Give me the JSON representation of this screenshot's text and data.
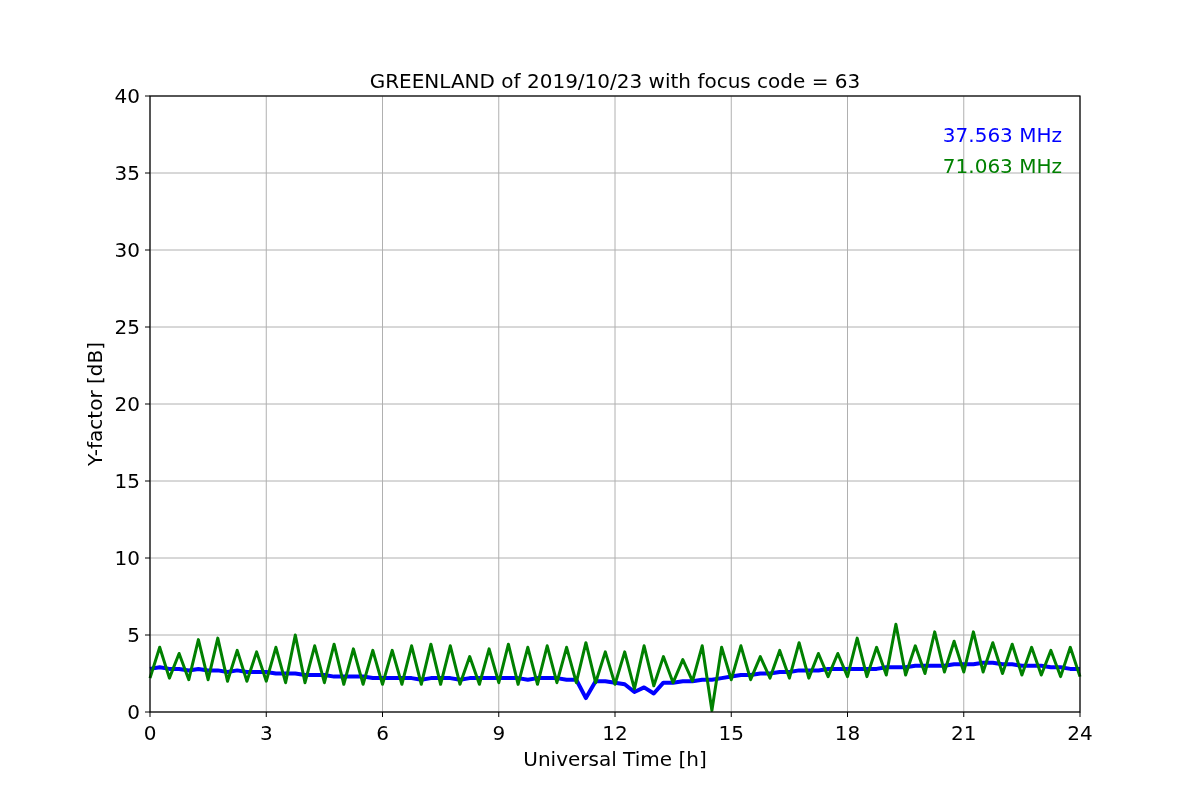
{
  "figure": {
    "chart_data": {
      "type": "line",
      "title": "GREENLAND of 2019/10/23 with focus code = 63",
      "xlabel": "Universal Time [h]",
      "ylabel": "Y-factor [dB]",
      "x": [
        0,
        0.25,
        0.5,
        0.75,
        1,
        1.25,
        1.5,
        1.75,
        2,
        2.25,
        2.5,
        2.75,
        3,
        3.25,
        3.5,
        3.75,
        4,
        4.25,
        4.5,
        4.75,
        5,
        5.25,
        5.5,
        5.75,
        6,
        6.25,
        6.5,
        6.75,
        7,
        7.25,
        7.5,
        7.75,
        8,
        8.25,
        8.5,
        8.75,
        9,
        9.25,
        9.5,
        9.75,
        10,
        10.25,
        10.5,
        10.75,
        11,
        11.25,
        11.5,
        11.75,
        12,
        12.25,
        12.5,
        12.75,
        13,
        13.25,
        13.5,
        13.75,
        14,
        14.25,
        14.5,
        14.75,
        15,
        15.25,
        15.5,
        15.75,
        16,
        16.25,
        16.5,
        16.75,
        17,
        17.25,
        17.5,
        17.75,
        18,
        18.25,
        18.5,
        18.75,
        19,
        19.25,
        19.5,
        19.75,
        20,
        20.25,
        20.5,
        20.75,
        21,
        21.25,
        21.5,
        21.75,
        22,
        22.25,
        22.5,
        22.75,
        23,
        23.25,
        23.5,
        23.75,
        24
      ],
      "series": [
        {
          "name": "37.563 MHz",
          "color": "#0000ff",
          "values": [
            2.8,
            2.9,
            2.8,
            2.8,
            2.7,
            2.8,
            2.7,
            2.7,
            2.6,
            2.7,
            2.6,
            2.6,
            2.6,
            2.5,
            2.5,
            2.5,
            2.4,
            2.4,
            2.4,
            2.3,
            2.3,
            2.3,
            2.3,
            2.2,
            2.2,
            2.2,
            2.2,
            2.2,
            2.1,
            2.2,
            2.2,
            2.2,
            2.1,
            2.2,
            2.2,
            2.2,
            2.2,
            2.2,
            2.2,
            2.1,
            2.2,
            2.2,
            2.2,
            2.1,
            2.1,
            0.9,
            2.0,
            2.0,
            1.9,
            1.8,
            1.3,
            1.6,
            1.2,
            1.9,
            1.9,
            2.0,
            2.0,
            2.1,
            2.1,
            2.2,
            2.3,
            2.4,
            2.4,
            2.5,
            2.5,
            2.6,
            2.6,
            2.7,
            2.7,
            2.7,
            2.8,
            2.8,
            2.8,
            2.8,
            2.8,
            2.8,
            2.9,
            2.9,
            2.9,
            3.0,
            3.0,
            3.0,
            3.0,
            3.1,
            3.1,
            3.1,
            3.2,
            3.2,
            3.1,
            3.1,
            3.0,
            3.0,
            3.0,
            2.9,
            2.9,
            2.8,
            2.8
          ]
        },
        {
          "name": "71.063 MHz",
          "color": "#008000",
          "values": [
            2.2,
            4.2,
            2.2,
            3.8,
            2.1,
            4.7,
            2.1,
            4.8,
            2.0,
            4.0,
            2.0,
            3.9,
            2.0,
            4.2,
            1.9,
            5.0,
            1.9,
            4.3,
            1.9,
            4.4,
            1.8,
            4.1,
            1.8,
            4.0,
            1.8,
            4.0,
            1.8,
            4.3,
            1.8,
            4.4,
            1.8,
            4.3,
            1.8,
            3.6,
            1.8,
            4.1,
            1.9,
            4.4,
            1.8,
            4.2,
            1.8,
            4.3,
            1.9,
            4.2,
            1.9,
            4.5,
            1.9,
            3.9,
            1.8,
            3.9,
            1.5,
            4.3,
            1.7,
            3.6,
            1.9,
            3.4,
            2.0,
            4.3,
            0.1,
            4.2,
            2.1,
            4.3,
            2.1,
            3.6,
            2.2,
            4.0,
            2.2,
            4.5,
            2.2,
            3.8,
            2.3,
            3.8,
            2.3,
            4.8,
            2.3,
            4.2,
            2.4,
            5.7,
            2.4,
            4.3,
            2.5,
            5.2,
            2.6,
            4.6,
            2.6,
            5.2,
            2.6,
            4.5,
            2.5,
            4.4,
            2.4,
            4.2,
            2.4,
            4.0,
            2.3,
            4.2,
            2.3
          ]
        }
      ],
      "grid": true,
      "xlim": [
        0,
        24
      ],
      "ylim": [
        0,
        40
      ],
      "xticks": [
        0,
        3,
        6,
        9,
        12,
        15,
        18,
        21,
        24
      ],
      "yticks": [
        0,
        5,
        10,
        15,
        20,
        25,
        30,
        35,
        40
      ]
    }
  }
}
